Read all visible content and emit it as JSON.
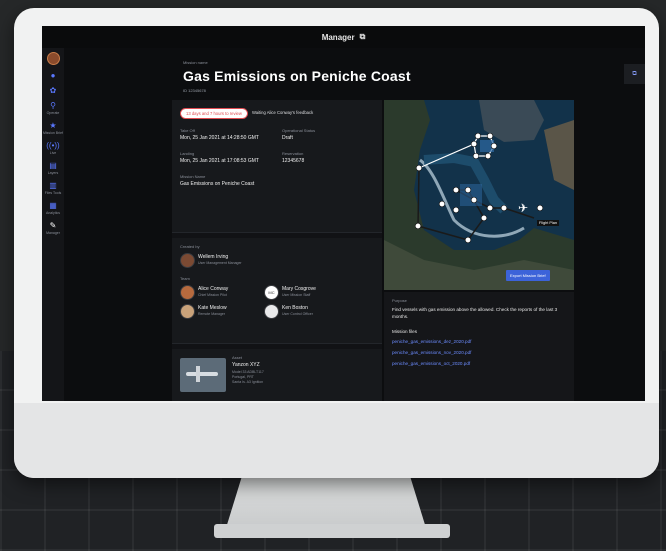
{
  "window": {
    "title": "Manager"
  },
  "sidebar": {
    "items": [
      {
        "label": "",
        "icon": "avatar"
      },
      {
        "label": "",
        "icon": "drop-icon"
      },
      {
        "label": "",
        "icon": "gear-icon"
      },
      {
        "label": "Operate",
        "icon": "search-icon"
      },
      {
        "label": "Mission Brief",
        "icon": "star-icon"
      },
      {
        "label": "Live",
        "icon": "broadcast-icon"
      },
      {
        "label": "Layers",
        "icon": "database-icon"
      },
      {
        "label": "Files Tools",
        "icon": "bars-icon"
      },
      {
        "label": "Analytics",
        "icon": "report-icon"
      },
      {
        "label": "Manager",
        "icon": "pencil-icon"
      }
    ]
  },
  "header": {
    "subtitle": "Mission name",
    "title": "Gas Emissions on Peniche Coast",
    "id": "ID 12345678"
  },
  "status": {
    "pill": "13 days and 7 hours to review",
    "waiting": "Waiting Alice Conway's feedback"
  },
  "fields": {
    "take_off_label": "Take Off",
    "take_off": "Mon, 25 Jan 2021 at 14:28:50 GMT",
    "landing_label": "Landing",
    "landing": "Mon, 25 Jan 2021 at 17:08:53 GMT",
    "mission_name_label": "Mission Name",
    "mission_name": "Gas Emissions on Peniche Coast",
    "operational_status_label": "Operational Status",
    "operational_status": "Draft",
    "reservation_label": "Reservation",
    "reservation": "12345678"
  },
  "team": {
    "created_by_label": "Created by",
    "creator_name": "Wellem Irving",
    "creator_role": "User Management Manager",
    "team_label": "Team",
    "members": [
      {
        "name": "Alice Conway",
        "role": "Chief Mission Pilot"
      },
      {
        "name": "Mary Cosgrove",
        "role": "User Mission Staff",
        "initials": "MC"
      },
      {
        "name": "Kate Meslow",
        "role": "Remote Manager"
      },
      {
        "name": "Ken Boston",
        "role": "User Control Officer"
      }
    ]
  },
  "asset": {
    "label": "Asset",
    "name": "Yanzon XYZ",
    "line1": "Model 33 ADBLT117",
    "line2": "Portugal, PRT",
    "line3": "Santa Is. A3 Ignition"
  },
  "map": {
    "export_label": "Export Mission Brief",
    "flight_plan_label": "Flight Plan"
  },
  "details": {
    "purpose_label": "Purpose",
    "purpose": "Find vessels with gas emission above the allowed. Check the reports of the last 3 months.",
    "files_label": "Mission files",
    "files": [
      "peniche_gas_emissions_dez_2020.pdf",
      "peniche_gas_emissions_nov_2020.pdf",
      "peniche_gas_emissions_oct_2020.pdf"
    ]
  },
  "colors": {
    "accent": "#3c63d9",
    "alert": "#e04c52",
    "link": "#6c8cff"
  }
}
